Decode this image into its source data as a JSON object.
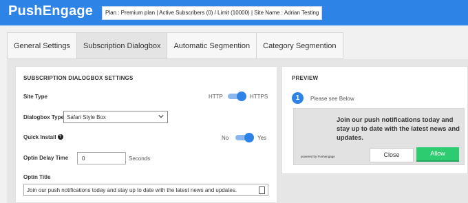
{
  "header": {
    "logo": "PushEngage",
    "plan_info": "Plan : Premium plan | Active Subscribers (0) / Limit (10000) | Site Name : Adrian Testing"
  },
  "tabs": [
    {
      "label": "General Settings",
      "active": false
    },
    {
      "label": "Subscription Dialogbox",
      "active": true
    },
    {
      "label": "Automatic Segmention",
      "active": false
    },
    {
      "label": "Category Segmention",
      "active": false
    }
  ],
  "settings": {
    "title": "SUBSCRIPTION DIALOGBOX SETTINGS",
    "site_type": {
      "label": "Site Type",
      "off_label": "HTTP",
      "on_label": "HTTPS",
      "value": "HTTPS"
    },
    "dialogbox_type": {
      "label": "Dialogbox Type",
      "value": "Safari Style Box"
    },
    "quick_install": {
      "label": "Quick Install",
      "off_label": "No",
      "on_label": "Yes",
      "value": "Yes"
    },
    "optin_delay": {
      "label": "Optin Delay Time",
      "value": "0",
      "unit": "Seconds"
    },
    "optin_title": {
      "label": "Optin Title",
      "value": "Join our push notifications today and stay up to date with the latest news and updates."
    }
  },
  "preview": {
    "title": "PREVIEW",
    "step_number": "1",
    "step_text": "Please see Below",
    "message": "Join our push notifications today and stay up to date with the latest news and updates.",
    "powered_by": "powered by Pushengage",
    "close_label": "Close",
    "allow_label": "Allow"
  },
  "colors": {
    "brand": "#2d84e6",
    "allow": "#2ecc71"
  }
}
